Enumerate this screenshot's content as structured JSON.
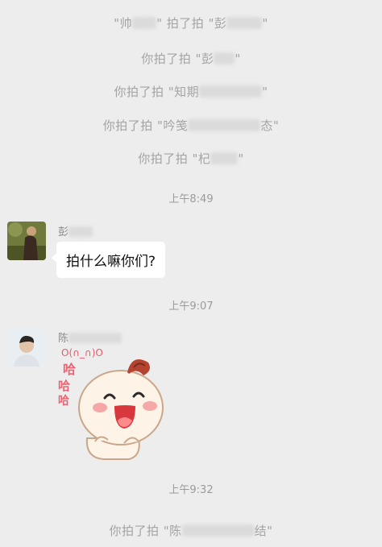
{
  "system_lines": [
    {
      "prefix": "\"帅",
      "suffix": "\" 拍了拍 \"彭",
      "end": "\""
    },
    {
      "prefix": "你拍了拍 \"彭",
      "suffix": "\"",
      "end": ""
    },
    {
      "prefix": "你拍了拍 \"知期",
      "suffix": "\"",
      "end": ""
    },
    {
      "prefix": "你拍了拍 \"吟笺",
      "suffix": "态\"",
      "end": ""
    },
    {
      "prefix": "你拍了拍 \"杞",
      "suffix": "\"",
      "end": ""
    }
  ],
  "timestamps": [
    "上午8:49",
    "上午9:07",
    "上午9:32"
  ],
  "message1": {
    "sender": "彭",
    "text": "拍什么嘛你们?"
  },
  "message2": {
    "sender": "陈",
    "sticker_text": "哈哈哈",
    "sticker_header": "O(∩_∩)O"
  },
  "final_line": {
    "prefix": "你拍了拍 \"陈",
    "suffix": "结\""
  },
  "icons": {
    "avatar1": "portrait-photo",
    "avatar2": "portrait-photo",
    "sticker": "laughing-baby-sticker"
  },
  "colors": {
    "background": "#ededed",
    "system_text": "#a3a3a3",
    "bubble": "#ffffff"
  }
}
